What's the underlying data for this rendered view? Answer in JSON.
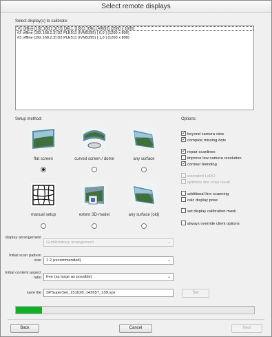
{
  "window": {
    "title": "Select remote displays"
  },
  "displays": {
    "label": "Select display(s) to calibrate:",
    "items": [
      "#1 offline [192.168.2.3] D1 DELL U3011 (DELL40693) (2560 x 1600)",
      "#2 offline [192.168.2.3] D2 PLE511 (IVM5395)  [ 0,0 ] (1200 x  800)",
      "#3 offline [192.168.2.3] D3 PLE511 (IVM5395)  [ 1,0 ] (1200 x  800)"
    ]
  },
  "setup": {
    "label": "Setup method:",
    "methods": [
      {
        "label": "flat screen",
        "icon": "flat-screen-icon",
        "selected": true
      },
      {
        "label": "curved screen / dome",
        "icon": "dome-icon",
        "selected": false
      },
      {
        "label": "any surface",
        "icon": "any-surface-icon",
        "selected": false
      },
      {
        "label": "manual setup",
        "icon": "warp-grid-icon",
        "selected": false
      },
      {
        "label": "extern 3D-model",
        "icon": "3d-model-icon",
        "selected": false
      },
      {
        "label": "any surface (old)",
        "icon": "any-surface-old-icon",
        "selected": false
      }
    ]
  },
  "options": {
    "label": "Options:",
    "items": [
      {
        "label": "beyond camera view",
        "checked": true,
        "disabled": false
      },
      {
        "label": "compute missing dots",
        "checked": true,
        "disabled": false
      },
      {
        "label": "repair scanlines",
        "checked": true,
        "disabled": false
      },
      {
        "label": "improve low camera resolution",
        "checked": false,
        "disabled": false
      },
      {
        "label": "contour blending",
        "checked": true,
        "disabled": false
      },
      {
        "label": "extended LoDO",
        "checked": false,
        "disabled": true
      },
      {
        "label": "optimize line scan result",
        "checked": false,
        "disabled": true
      },
      {
        "label": "additional line scanning",
        "checked": false,
        "disabled": false
      },
      {
        "label": "calc display pose",
        "checked": false,
        "disabled": false
      },
      {
        "label": "set display calibration mask",
        "checked": false,
        "disabled": false
      },
      {
        "label": "always override client options",
        "checked": false,
        "disabled": false
      }
    ]
  },
  "fields": {
    "arrangement": {
      "label": "display arrangement",
      "value": "Grid/Arbitrary arrangement",
      "disabled": true
    },
    "pattern": {
      "label": "Initial scan pattern size",
      "value": "1.2 (recommended)"
    },
    "aspect": {
      "label": "Initial content aspect ratio",
      "value": "free (as large as possible)"
    },
    "savefile": {
      "label": "save file",
      "value": "SPSuperSet_151028_142657_159.sps",
      "set_button": "Set"
    }
  },
  "progress": {
    "fraction": 0.11,
    "color": "#0fb028"
  },
  "buttons": {
    "back": "Back",
    "cancel": "Cancel",
    "next": "Next"
  }
}
